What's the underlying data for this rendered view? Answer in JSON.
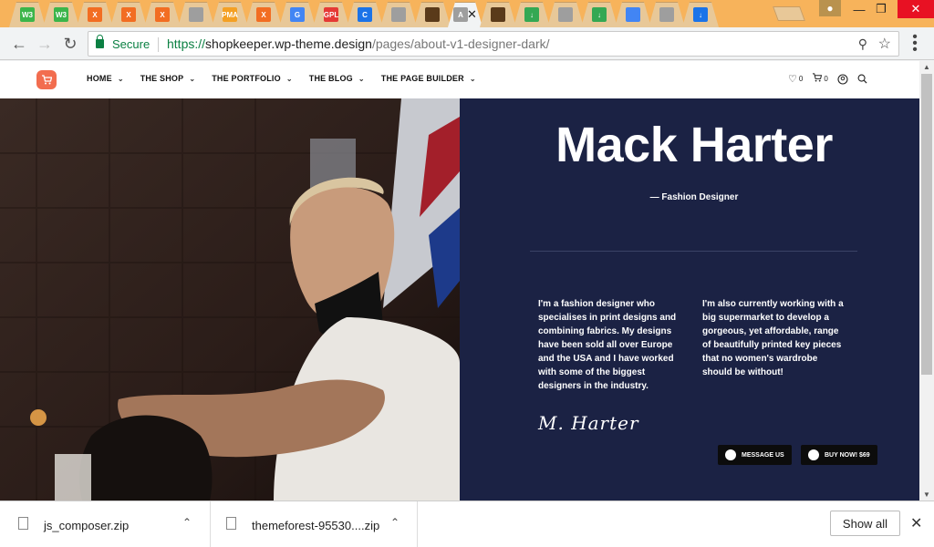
{
  "browser": {
    "tabs": [
      {
        "icon": "w3-favicon-icon",
        "color": "#3bb54a",
        "glyph": "W3"
      },
      {
        "icon": "w3-favicon-icon",
        "color": "#3bb54a",
        "glyph": "W3"
      },
      {
        "icon": "xampp-favicon-icon",
        "color": "#f26d22",
        "glyph": "X"
      },
      {
        "icon": "xampp-favicon-icon",
        "color": "#f26d22",
        "glyph": "X"
      },
      {
        "icon": "xampp-favicon-icon",
        "color": "#f26d22",
        "glyph": "X"
      },
      {
        "icon": "page-favicon-icon",
        "color": "#9e9e9e",
        "glyph": ""
      },
      {
        "icon": "phpmyadmin-favicon-icon",
        "color": "#f4a024",
        "glyph": "PMA"
      },
      {
        "icon": "xampp-favicon-icon",
        "color": "#f26d22",
        "glyph": "X"
      },
      {
        "icon": "google-favicon-icon",
        "color": "#4285f4",
        "glyph": "G"
      },
      {
        "icon": "gpl-favicon-icon",
        "color": "#e53935",
        "glyph": "GPL"
      },
      {
        "icon": "loading-favicon-icon",
        "color": "#1a73e8",
        "glyph": "C"
      },
      {
        "icon": "page-favicon-icon",
        "color": "#9e9e9e",
        "glyph": ""
      },
      {
        "icon": "image-favicon-icon",
        "color": "#5a3a1a",
        "glyph": ""
      },
      {
        "icon": "active-tab-favicon-icon",
        "color": "#9e9e9e",
        "glyph": "A",
        "active": true
      },
      {
        "icon": "image-favicon-icon",
        "color": "#5a3a1a",
        "glyph": ""
      },
      {
        "icon": "download-favicon-icon",
        "color": "#34a853",
        "glyph": "↓"
      },
      {
        "icon": "page-favicon-icon",
        "color": "#9e9e9e",
        "glyph": ""
      },
      {
        "icon": "download-favicon-icon",
        "color": "#34a853",
        "glyph": "↓"
      },
      {
        "icon": "docs-favicon-icon",
        "color": "#4285f4",
        "glyph": ""
      },
      {
        "icon": "page-favicon-icon",
        "color": "#9e9e9e",
        "glyph": ""
      },
      {
        "icon": "download-arrow-favicon-icon",
        "color": "#1a73e8",
        "glyph": "↓"
      }
    ],
    "close_glyph": "✕",
    "secure_label": "Secure",
    "url_scheme": "https://",
    "url_host": "shopkeeper.wp-theme.design",
    "url_path": "/pages/about-v1-designer-dark/"
  },
  "site": {
    "nav": [
      {
        "label": "HOME"
      },
      {
        "label": "THE SHOP"
      },
      {
        "label": "THE PORTFOLIO"
      },
      {
        "label": "THE BLOG"
      },
      {
        "label": "THE PAGE BUILDER"
      }
    ],
    "wishlist_count": "0",
    "cart_count": "0",
    "accent_color": "#f26d4f"
  },
  "hero": {
    "name": "Mack Harter",
    "role": "— Fashion Designer",
    "bio_left": "I'm a fashion designer who specialises in print designs and combining fabrics. My designs have been sold all over Europe and the USA and I have worked with some of the biggest designers in the industry.",
    "bio_right": "I'm also currently working with a big supermarket to develop a gorgeous, yet affordable, range of beautifully printed key pieces that no women's wardrobe should be without!",
    "signature": "M. Harter",
    "message_button": "MESSAGE US",
    "buy_button": "BUY NOW! $69",
    "panel_color": "#1b2244"
  },
  "downloads": {
    "items": [
      {
        "filename": "js_composer.zip"
      },
      {
        "filename": "themeforest-95530....zip"
      }
    ],
    "show_all": "Show all"
  }
}
